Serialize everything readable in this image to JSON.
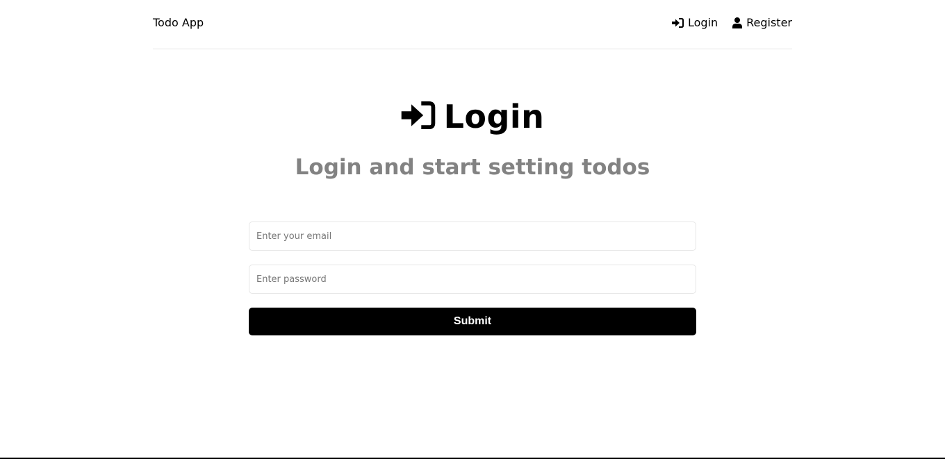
{
  "header": {
    "brand": "Todo App",
    "nav": [
      {
        "label": "Login",
        "icon": "sign-in-icon"
      },
      {
        "label": "Register",
        "icon": "user-icon"
      }
    ]
  },
  "main": {
    "title": "Login",
    "title_icon": "sign-in-icon",
    "subtitle": "Login and start setting todos"
  },
  "form": {
    "email_placeholder": "Enter your email",
    "email_value": "",
    "password_placeholder": "Enter password",
    "password_value": "",
    "submit_label": "Submit"
  },
  "colors": {
    "primary": "#000000",
    "subtitle": "#828282",
    "border": "#e6e6e6",
    "background": "#ffffff"
  }
}
